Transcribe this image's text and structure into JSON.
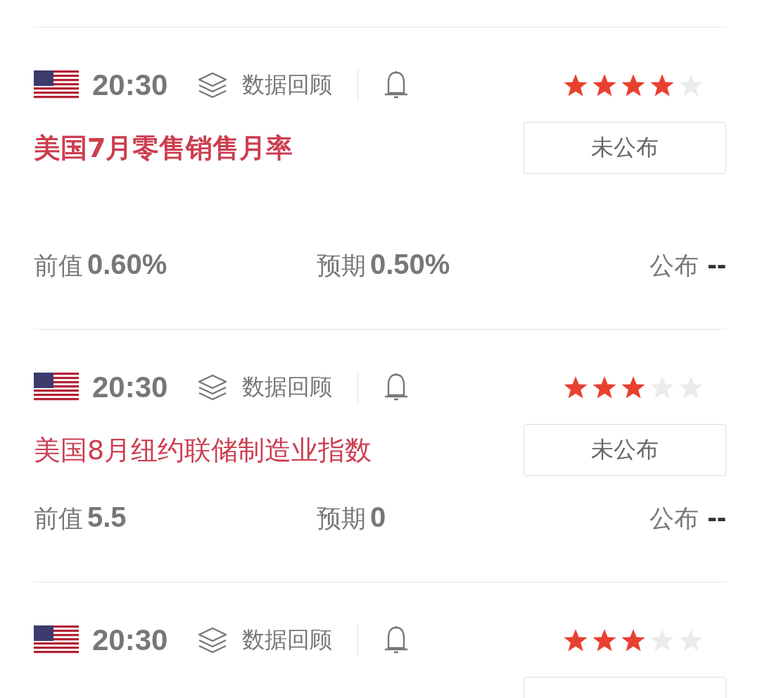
{
  "events": [
    {
      "time": "20:30",
      "tag": "数据回顾",
      "stars": 4,
      "title": "美国7月零售销售月率",
      "bold": true,
      "status": "未公布",
      "values": [
        {
          "label": "前值",
          "value": "0.60%"
        },
        {
          "label": "预期",
          "value": "0.50%"
        },
        {
          "label": "公布",
          "value": "--"
        }
      ]
    },
    {
      "time": "20:30",
      "tag": "数据回顾",
      "stars": 3,
      "title": "美国8月纽约联储制造业指数",
      "bold": false,
      "status": "未公布",
      "values": [
        {
          "label": "前值",
          "value": "5.5"
        },
        {
          "label": "预期",
          "value": "0"
        },
        {
          "label": "公布",
          "value": "--"
        }
      ]
    },
    {
      "time": "20:30",
      "tag": "数据回顾",
      "stars": 3
    }
  ]
}
